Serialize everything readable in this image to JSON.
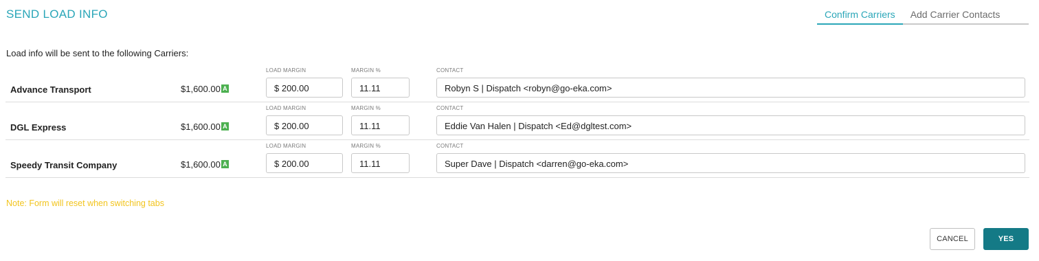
{
  "header": {
    "title": "SEND LOAD INFO",
    "tabs": [
      {
        "label": "Confirm Carriers",
        "active": true
      },
      {
        "label": "Add Carrier Contacts",
        "active": false
      }
    ]
  },
  "intro_text": "Load info will be sent to the following Carriers:",
  "columns": {
    "load_margin": "LOAD MARGIN",
    "margin_pct": "MARGIN %",
    "contact": "CONTACT"
  },
  "carriers": [
    {
      "name": "Advance Transport",
      "amount": "$1,600.00",
      "badge": "A",
      "load_margin": "$ 200.00",
      "margin_pct": "11.11",
      "contact": "Robyn S | Dispatch <robyn@go-eka.com>"
    },
    {
      "name": "DGL Express",
      "amount": "$1,600.00",
      "badge": "A",
      "load_margin": "$ 200.00",
      "margin_pct": "11.11",
      "contact": "Eddie Van Halen | Dispatch <Ed@dgltest.com>"
    },
    {
      "name": "Speedy Transit Company",
      "amount": "$1,600.00",
      "badge": "A",
      "load_margin": "$ 200.00",
      "margin_pct": "11.11",
      "contact": "Super Dave | Dispatch <darren@go-eka.com>"
    }
  ],
  "note": "Note: Form will reset when switching tabs",
  "actions": {
    "cancel_label": "CANCEL",
    "yes_label": "YES"
  },
  "colors": {
    "accent": "#2aa6b8",
    "primary_button": "#147a86",
    "note": "#f2c41d",
    "badge": "#4cb050"
  }
}
